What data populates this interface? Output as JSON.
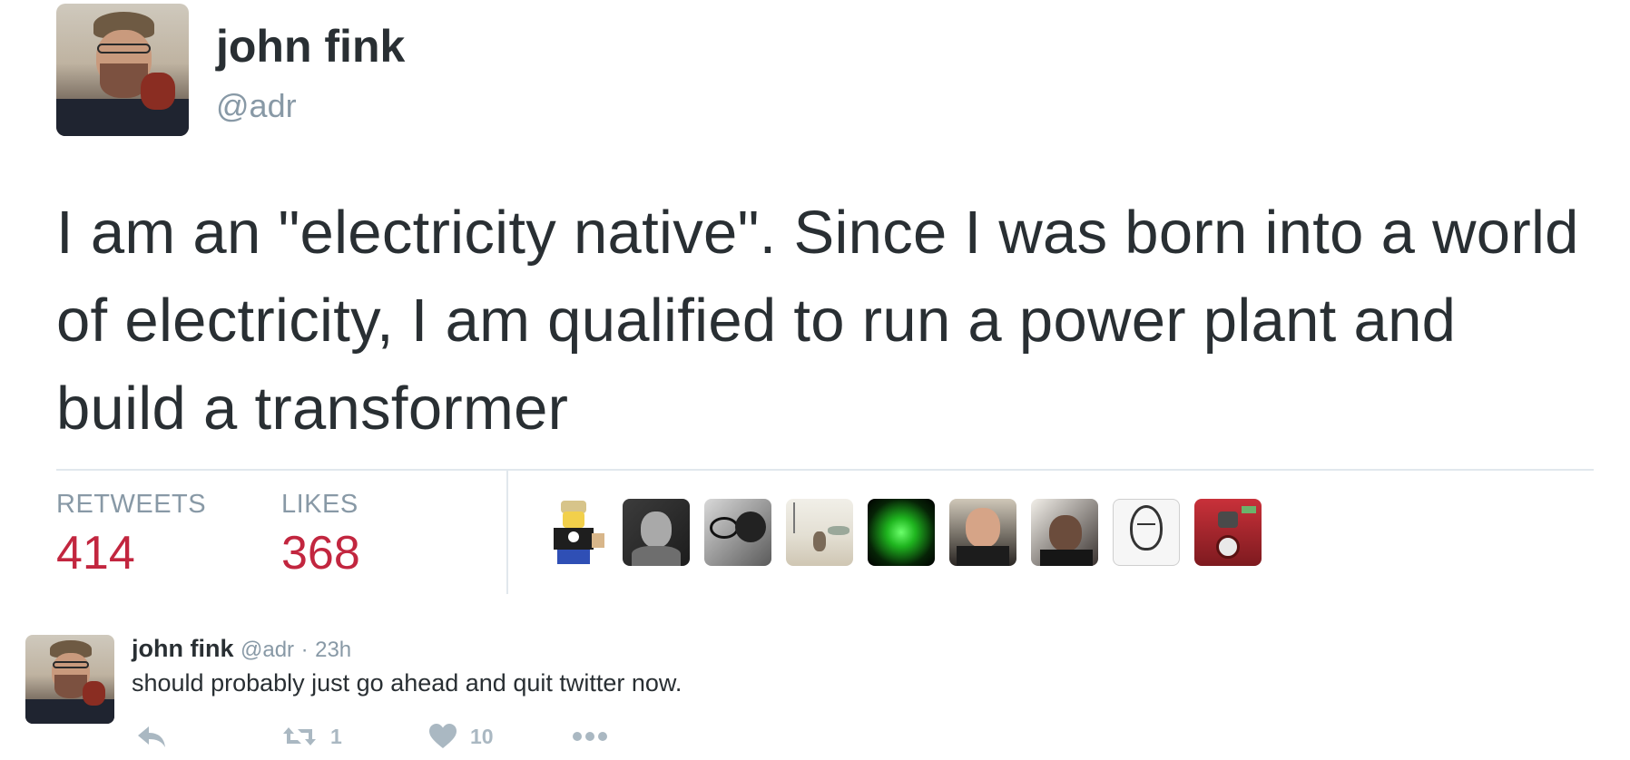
{
  "tweet": {
    "author_name": "john fink",
    "author_handle": "@adr",
    "text": "I am an \"electricity native\". Since I was born into a world of electricity, I am qualified to run a power plant and build a transformer",
    "stats": {
      "retweets_label": "RETWEETS",
      "retweets_value": "414",
      "likes_label": "LIKES",
      "likes_value": "368"
    },
    "likers": [
      "lego-figure-avatar",
      "gray-portrait-avatar",
      "glasses-bw-avatar",
      "street-photo-avatar",
      "green-logo-avatar",
      "bald-man-avatar",
      "dark-selfie-avatar",
      "sketch-avatar",
      "red-robot-avatar"
    ]
  },
  "reply": {
    "author_name": "john fink",
    "author_handle": "@adr",
    "separator": "·",
    "time": "23h",
    "text": "should probably just go ahead and quit twitter now.",
    "actions": {
      "retweet_count": "1",
      "like_count": "10"
    }
  },
  "colors": {
    "stat_value": "#c2263f",
    "muted": "#8899a6",
    "text": "#292f33"
  }
}
